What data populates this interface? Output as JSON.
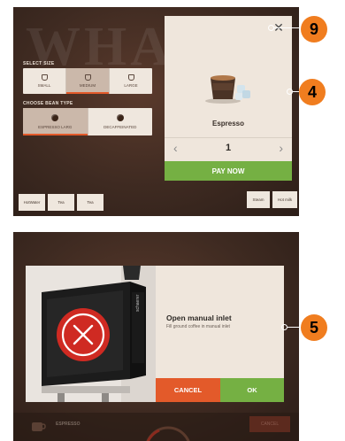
{
  "screen1": {
    "background_text": "WHAT",
    "select_size": {
      "label": "SELECT SIZE",
      "options": [
        "SMALL",
        "MEDIUM",
        "LARGE"
      ],
      "selected": "MEDIUM"
    },
    "bean_type": {
      "label": "CHOOSE BEAN TYPE",
      "options": [
        "ESPRESSO LARG",
        "DECAFFEINATED"
      ],
      "selected": "ESPRESSO LARG"
    },
    "product": {
      "name": "Espresso",
      "quantity": "1",
      "prev": "‹",
      "next": "›",
      "close": "✕",
      "pay_label": "PAY NOW"
    },
    "bottom_buttons": {
      "hot_water": "HotWater",
      "tea1": "Tea",
      "tea2": "Tea",
      "steam": "Steam",
      "hot_milk": "Hot milk"
    },
    "callouts": [
      "9",
      "4"
    ]
  },
  "screen2": {
    "dialog": {
      "title": "Open manual inlet",
      "message": "Fill ground coffee in manual inlet",
      "brand": "schaerer",
      "cancel_label": "CANCEL",
      "ok_label": "OK"
    },
    "footer": {
      "product": "ESPRESSO",
      "cancel": "CANCEL"
    },
    "callouts": [
      "5"
    ]
  },
  "colors": {
    "accent_orange": "#e35a2a",
    "accent_green": "#75b043",
    "callout_badge": "#f07d1f",
    "panel": "#efe6dc",
    "background": "#3e2a21"
  }
}
